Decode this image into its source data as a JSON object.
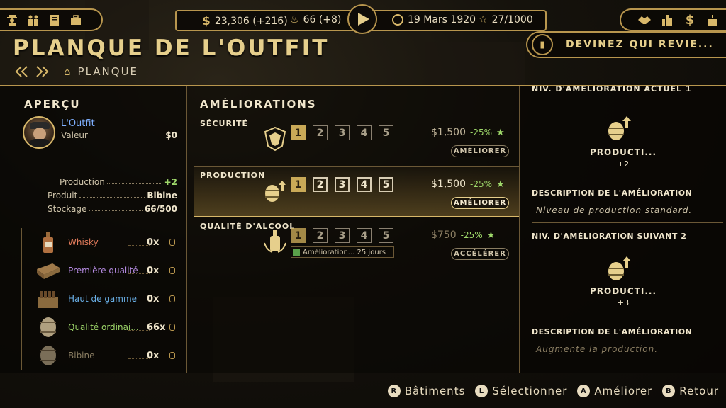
{
  "topbar": {
    "left_icons": [
      "boss-icon",
      "crew-icon",
      "ledger-icon",
      "briefcase-icon"
    ],
    "money": "23,306 (+216)",
    "heat": "66 (+8)",
    "date": "19 Mars 1920",
    "reputation": "27/1000",
    "right_icons": [
      "handshake-icon",
      "city-icon",
      "dollar-icon",
      "cake-icon"
    ]
  },
  "header": {
    "title": "PLANQUE DE L'OUTFIT",
    "breadcrumb": "PLANQUE",
    "mission_text": "DEVINEZ QUI REVIE..."
  },
  "overview": {
    "heading": "APERÇU",
    "owner": "L'Outfit",
    "value_label": "Valeur",
    "value": "$0",
    "production_label": "Production",
    "production_value": "+2",
    "product_label": "Produit",
    "product_value": "Bibine",
    "storage_label": "Stockage",
    "storage_value": "66/500",
    "products": [
      {
        "name": "Whisky",
        "qty": "0x",
        "color": "#e07a5a"
      },
      {
        "name": "Première qualité",
        "qty": "0x",
        "color": "#b48ae0"
      },
      {
        "name": "Haut de gamme",
        "qty": "0x",
        "color": "#6ab0e8"
      },
      {
        "name": "Qualité ordinai...",
        "qty": "66x",
        "color": "#9ed76a"
      },
      {
        "name": "Bibine",
        "qty": "0x",
        "color": "#8a7d62"
      }
    ]
  },
  "improvements": {
    "heading": "AMÉLIORATIONS",
    "levels": [
      "1",
      "2",
      "3",
      "4",
      "5"
    ],
    "rows": [
      {
        "title": "SÉCURITÉ",
        "price": "$1,500",
        "discount": "-25%",
        "button": "AMÉLIORER"
      },
      {
        "title": "PRODUCTION",
        "price": "$1,500",
        "discount": "-25%",
        "button": "AMÉLIORER"
      },
      {
        "title": "QUALITÉ D'ALCOOL",
        "price": "$750",
        "discount": "-25%",
        "button": "ACCÉLÉRER",
        "progress": "Amélioration... 25 jours"
      }
    ]
  },
  "details": {
    "cut_heading": "NIV. D'AMÉLIORATION ACTUEL 1",
    "current_name": "PRODUCTI...",
    "current_value": "+2",
    "desc_heading": "DESCRIPTION DE L'AMÉLIORATION",
    "current_desc": "Niveau de production standard.",
    "next_heading": "NIV. D'AMÉLIORATION SUIVANT 2",
    "next_name": "PRODUCTI...",
    "next_value": "+3",
    "desc_heading2": "DESCRIPTION DE L'AMÉLIORATION",
    "next_desc": "Augmente la production."
  },
  "controls": [
    {
      "key": "R",
      "label": "Bâtiments"
    },
    {
      "key": "L",
      "label": "Sélectionner"
    },
    {
      "key": "A",
      "label": "Améliorer"
    },
    {
      "key": "B",
      "label": "Retour"
    }
  ],
  "colors": {
    "gold": "#d8b86a",
    "green": "#9ed76a",
    "link_blue": "#7fb0ff"
  }
}
